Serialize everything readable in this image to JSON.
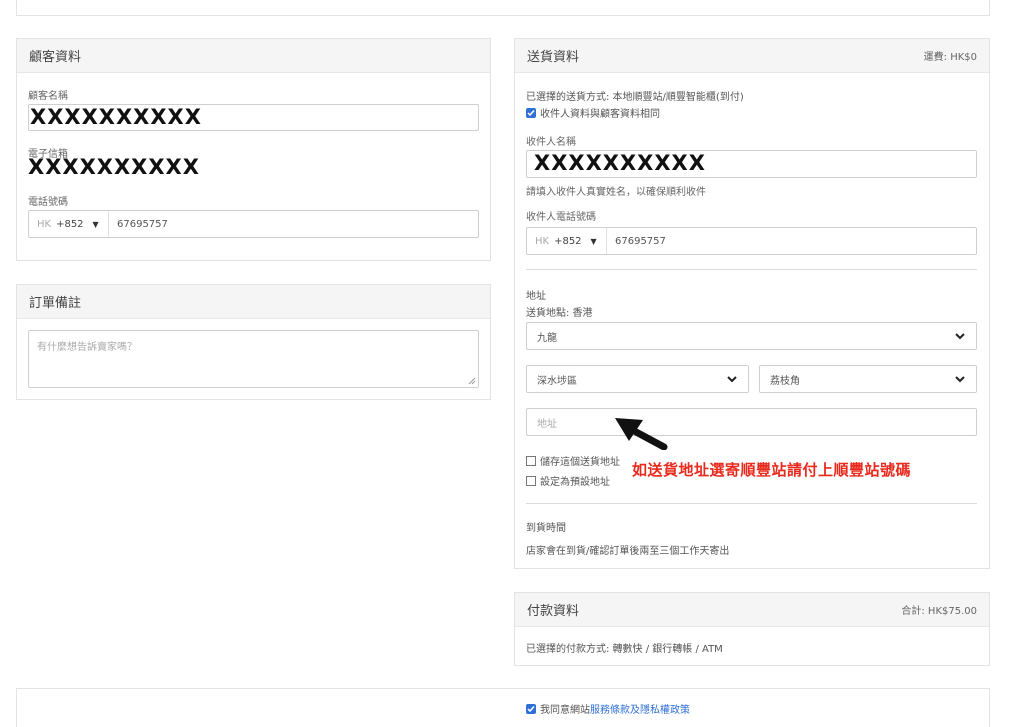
{
  "customer": {
    "title": "顧客資料",
    "name_label": "顧客名稱",
    "name_value": "XXXXXXXXXX",
    "email_label": "電子信箱",
    "email_value": "XXXXXXXXXX",
    "phone_label": "電話號碼",
    "phone_country": "HK",
    "phone_code": "+852",
    "phone_number": "67695757"
  },
  "order_note": {
    "title": "訂單備註",
    "placeholder": "有什麼想告訴賣家嗎？"
  },
  "delivery": {
    "title": "送貨資料",
    "shipping_fee": "運費: HK$0",
    "method_text": "已選擇的送貨方式: 本地順豐站/順豐智能櫃(到付)",
    "same_as_customer": "收件人資料與顧客資料相同",
    "recipient_label": "收件人名稱",
    "recipient_value": "XXXXXXXXXX",
    "recipient_hint": "請填入收件人真實姓名，以確保順利收件",
    "recipient_phone_label": "收件人電話號碼",
    "phone_country": "HK",
    "phone_code": "+852",
    "phone_number": "67695757",
    "address_label": "地址",
    "location_text": "送貨地點: 香港",
    "region": "九龍",
    "district": "深水埗區",
    "area": "荔枝角",
    "address_placeholder": "地址",
    "save_address": "儲存這個送貨地址",
    "set_default": "設定為預設地址",
    "arrival_label": "到貨時間",
    "arrival_text": "店家會在到貨/確認訂單後兩至三個工作天寄出"
  },
  "annotation": {
    "text": "如送貨地址選寄順豐站請付上順豐站號碼"
  },
  "payment": {
    "title": "付款資料",
    "total": "合計: HK$75.00",
    "method_text": "已選擇的付款方式: 轉數快 / 銀行轉帳 / ATM"
  },
  "agreement": {
    "prefix": "我同意網站",
    "link": "服務條款及隱私權政策"
  }
}
